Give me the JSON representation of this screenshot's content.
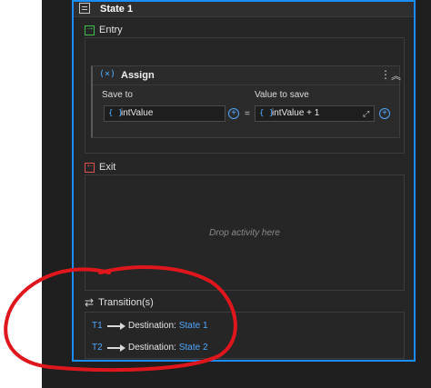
{
  "state": {
    "title": "State 1",
    "entry": {
      "label": "Entry",
      "activity": {
        "icon": "assign-icon",
        "icon_text": "(×)",
        "title": "Assign",
        "save_to_label": "Save to",
        "save_to_value": "intValue",
        "value_label": "Value to save",
        "value": "intValue + 1",
        "equals": "="
      }
    },
    "exit": {
      "label": "Exit",
      "drop_placeholder": "Drop activity here"
    },
    "transitions": {
      "label": "Transition(s)",
      "items": [
        {
          "id": "T1",
          "destination_label": "Destination:",
          "destination": "State 1"
        },
        {
          "id": "T2",
          "destination_label": "Destination:",
          "destination": "State 2"
        }
      ]
    }
  },
  "colors": {
    "accent": "#1a8dff",
    "link": "#4fa8ff",
    "annotation": "#e0161d",
    "background": "#1f1f1f"
  }
}
